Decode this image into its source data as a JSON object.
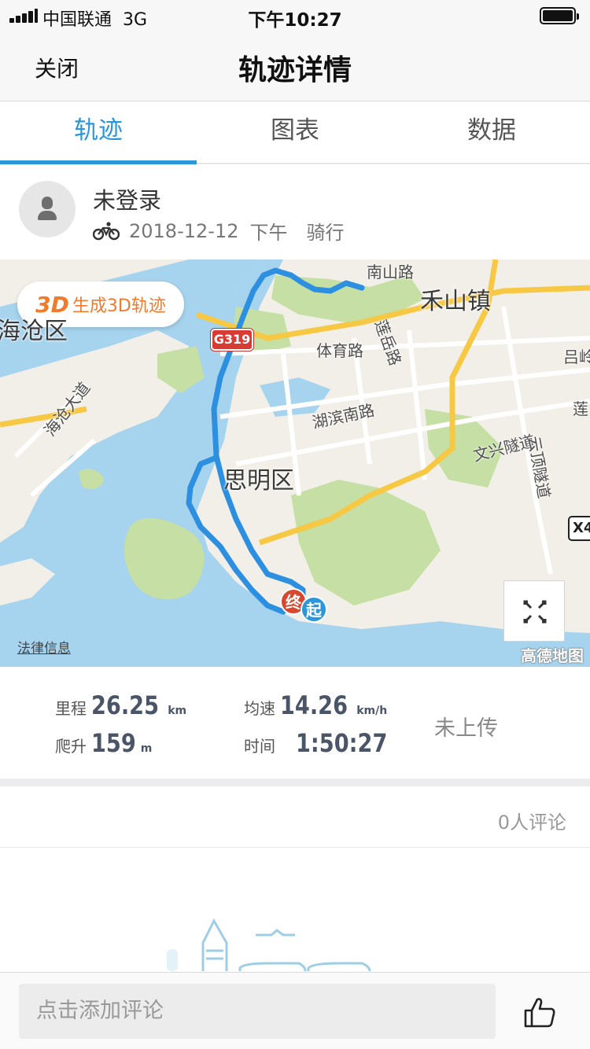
{
  "status_bar": {
    "carrier": "中国联通",
    "network": "3G",
    "time": "下午10:27",
    "battery_level": 1.0
  },
  "nav": {
    "close_label": "关闭",
    "title": "轨迹详情"
  },
  "tabs": [
    {
      "label": "轨迹",
      "active": true
    },
    {
      "label": "图表",
      "active": false
    },
    {
      "label": "数据",
      "active": false
    }
  ],
  "user": {
    "name": "未登录",
    "date": "2018-12-12",
    "period": "下午",
    "activity": "骑行"
  },
  "map": {
    "button_3d_logo": "3D",
    "button_3d_label": "生成3D轨迹",
    "legal_link": "法律信息",
    "provider": "高德地图",
    "road_badge": "G319",
    "badge_x": "X4",
    "marker_start": "起",
    "marker_end": "终",
    "labels": {
      "district": "思明区",
      "town": "禾山镇",
      "haicang": "海沧区",
      "tiyu_road": "体育路",
      "lianyue_road": "莲岳路",
      "hubin_south": "湖滨南路",
      "haicang_ave": "海沧大道",
      "wenxing_tunnel": "文兴隧道",
      "yunding_tunnel": "云顶隧道",
      "nanshan_road": "南山路",
      "lvling": "吕岭",
      "lian": "莲"
    },
    "route_color": "#2d8fe0"
  },
  "stats": {
    "distance": {
      "label": "里程",
      "value": "26.25",
      "unit": "km"
    },
    "climb": {
      "label": "爬升",
      "value": "159",
      "unit": "m"
    },
    "avg_speed": {
      "label": "均速",
      "value": "14.26",
      "unit": "km/h"
    },
    "duration": {
      "label": "时间",
      "value": "1:50:27"
    },
    "upload_status": "未上传"
  },
  "comments": {
    "count_label": "0人评论",
    "input_placeholder": "点击添加评论"
  },
  "icons": {
    "bike": "bike-icon",
    "avatar": "user-avatar-icon",
    "expand": "expand-icon",
    "like": "thumbs-up-icon"
  },
  "colors": {
    "accent": "#2b97d8",
    "map_water": "#a6d3ee",
    "map_green": "#c5dfa4",
    "marker_end": "#d8472f",
    "marker_start": "#2b97d8"
  }
}
